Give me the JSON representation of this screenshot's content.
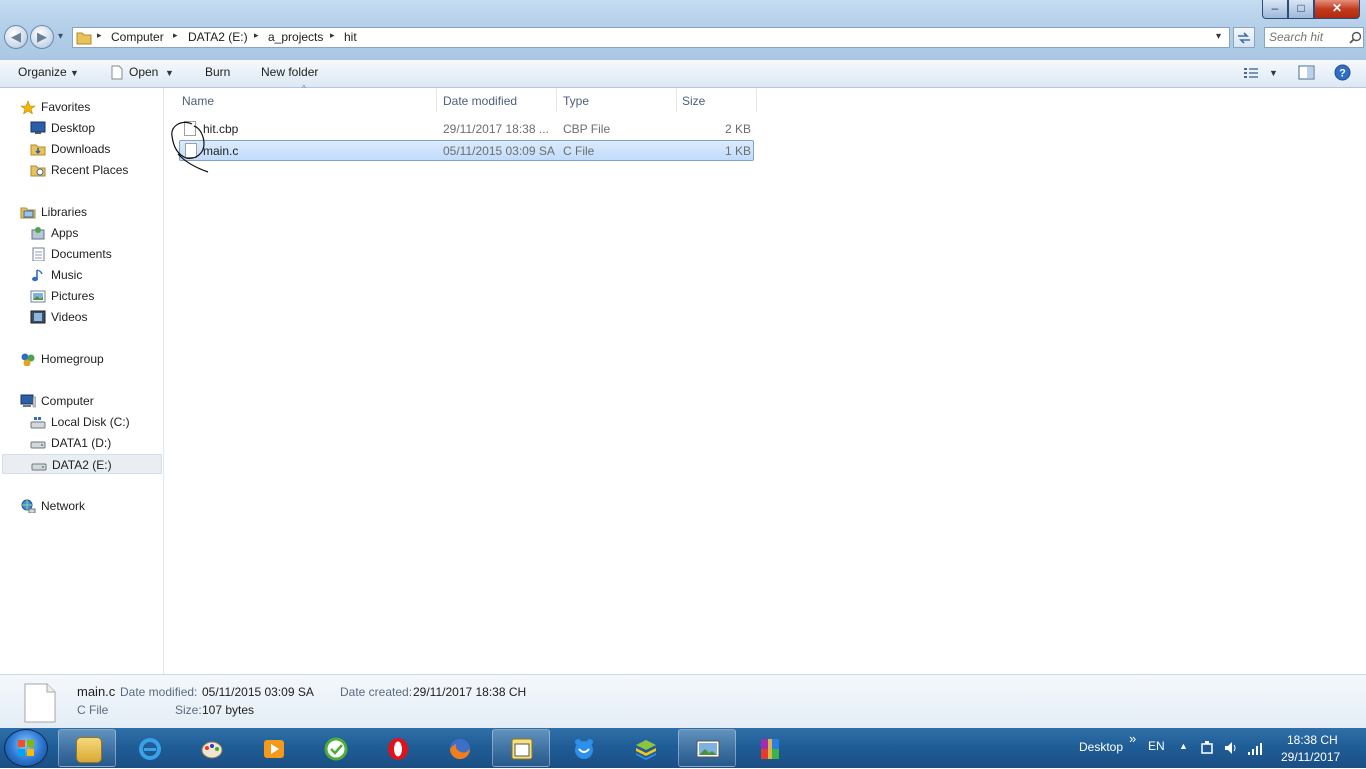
{
  "window": {
    "minimize_glyph": "–",
    "maximize_glyph": "□",
    "close_glyph": "✕"
  },
  "nav": {
    "back_glyph": "◀",
    "forward_glyph": "▶",
    "dropdown_glyph": "▾"
  },
  "address": {
    "crumbs": [
      "Computer",
      "DATA2 (E:)",
      "a_projects",
      "hit"
    ],
    "separator": "▸"
  },
  "search": {
    "placeholder": "Search hit"
  },
  "toolbar": {
    "organize": "Organize",
    "open": "Open",
    "burn": "Burn",
    "new_folder": "New folder"
  },
  "sidebar": {
    "favorites": "Favorites",
    "desktop": "Desktop",
    "downloads": "Downloads",
    "recent_places": "Recent Places",
    "libraries": "Libraries",
    "apps": "Apps",
    "documents": "Documents",
    "music": "Music",
    "pictures": "Pictures",
    "videos": "Videos",
    "homegroup": "Homegroup",
    "computer": "Computer",
    "local_disk": "Local Disk (C:)",
    "data1": "DATA1 (D:)",
    "data2": "DATA2 (E:)",
    "network": "Network"
  },
  "files": {
    "columns": {
      "name": "Name",
      "date": "Date modified",
      "type": "Type",
      "size": "Size"
    },
    "rows": [
      {
        "name": "hit.cbp",
        "date": "29/11/2017 18:38 ...",
        "type": "CBP File",
        "size": "2 KB"
      },
      {
        "name": "main.c",
        "date": "05/11/2015 03:09 SA",
        "type": "C File",
        "size": "1 KB"
      }
    ]
  },
  "details": {
    "name": "main.c",
    "type": "C File",
    "date_modified_label": "Date modified:",
    "date_modified": "05/11/2015 03:09 SA",
    "date_created_label": "Date created:",
    "date_created": "29/11/2017 18:38 CH",
    "size_label": "Size:",
    "size": "107 bytes"
  },
  "taskbar": {
    "apps": [
      "windows-explorer-icon",
      "internet-explorer-icon",
      "paint-icon",
      "media-player-icon",
      "green-app-icon",
      "opera-icon",
      "firefox-icon",
      "calendar-app-icon",
      "blue-app-icon",
      "bluestacks-icon",
      "photo-viewer-icon",
      "winrar-icon"
    ],
    "desktop_label": "Desktop",
    "chevron": "»",
    "language": "EN",
    "time": "18:38 CH",
    "date": "29/11/2017"
  },
  "colors": {
    "selection": "#cce4fc",
    "taskbar": "#1f5c95",
    "window_frame": "#b4cfe9"
  }
}
